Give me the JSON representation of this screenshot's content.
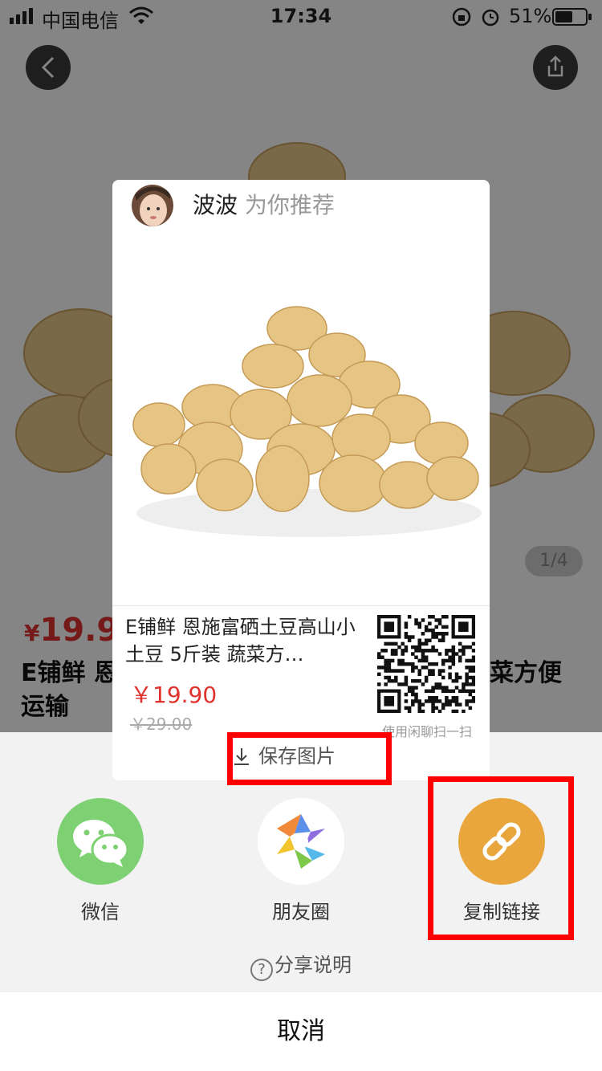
{
  "status_bar": {
    "carrier": "中国电信",
    "time": "17:34",
    "battery": "51%"
  },
  "product": {
    "price_symbol": "¥",
    "price": "19.90",
    "title_line1": "E铺鲜 恩",
    "title_line1_right": "菜方便",
    "title_line2": "运输",
    "image_counter": "1/4"
  },
  "poster": {
    "user_name": "波波",
    "recommend_text": "为你推荐",
    "title": "E铺鲜 恩施富硒土豆高山小土豆 5斤装 蔬菜方…",
    "price": "￥19.90",
    "original_price": "￥29.00",
    "qr_hint": "使用闲聊扫一扫",
    "save_label": "保存图片"
  },
  "share": {
    "items": [
      {
        "label": "微信",
        "icon": "wechat-icon",
        "color": "#7dd173"
      },
      {
        "label": "朋友圈",
        "icon": "moments-icon",
        "color": "#ffffff"
      },
      {
        "label": "复制链接",
        "icon": "link-icon",
        "color": "#e8a63c"
      }
    ],
    "help_text": "分享说明",
    "cancel_label": "取消"
  },
  "colors": {
    "price_red": "#e0332e",
    "highlight_red": "#ff0000",
    "copy_link_orange": "#e8a63c",
    "wechat_green": "#7dd173"
  }
}
